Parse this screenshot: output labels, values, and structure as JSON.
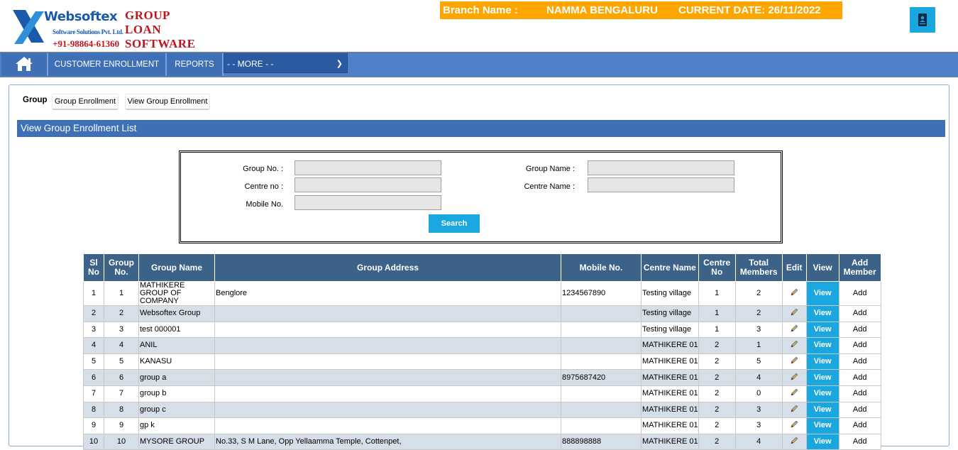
{
  "logo": {
    "brand": "Websoftex",
    "sub": "Software Solutions Pvt. Ltd.",
    "phone": "+91-98864-61360",
    "title_lines": [
      "GROUP",
      "LOAN",
      "SOFTWARE"
    ]
  },
  "branch": {
    "label": "Branch Name :",
    "name": "NAMMA BENGALURU",
    "date_label": "CURRENT DATE: 26/11/2022"
  },
  "nav": {
    "home_icon": "home-icon",
    "items": [
      "CUSTOMER ENROLLMENT",
      "REPORTS"
    ],
    "more_select": "- - MORE - -"
  },
  "tabs": {
    "label": "Group",
    "buttons": [
      "Group Enrollment",
      "View Group Enrollment"
    ]
  },
  "section_title": "View Group Enrollment List",
  "search": {
    "group_no_label": "Group No. :",
    "group_name_label": "Group Name :",
    "centre_no_label": "Centre no :",
    "centre_name_label": "Centre Name :",
    "mobile_label": "Mobile No.",
    "button": "Search"
  },
  "table": {
    "headers": [
      "Sl No",
      "Group No.",
      "Group Name",
      "Group Address",
      "Mobile No.",
      "Centre Name",
      "Centre No",
      "Total Members",
      "Edit",
      "View",
      "Add Member"
    ],
    "rows": [
      {
        "sl": "1",
        "group_no": "1",
        "name": "MATHIKERE GROUP OF COMPANY",
        "address": "Benglore",
        "mobile": "1234567890",
        "centre": "Testing village",
        "centre_no": "1",
        "members": "2",
        "view": "View",
        "add": "Add"
      },
      {
        "sl": "2",
        "group_no": "2",
        "name": "Websoftex Group",
        "address": "",
        "mobile": "",
        "centre": "Testing village",
        "centre_no": "1",
        "members": "2",
        "view": "View",
        "add": "Add"
      },
      {
        "sl": "3",
        "group_no": "3",
        "name": "test 000001",
        "address": "",
        "mobile": "",
        "centre": "Testing village",
        "centre_no": "1",
        "members": "3",
        "view": "View",
        "add": "Add"
      },
      {
        "sl": "4",
        "group_no": "4",
        "name": "ANIL",
        "address": "",
        "mobile": "",
        "centre": "MATHIKERE 01",
        "centre_no": "2",
        "members": "1",
        "view": "View",
        "add": "Add"
      },
      {
        "sl": "5",
        "group_no": "5",
        "name": "KANASU",
        "address": "",
        "mobile": "",
        "centre": "MATHIKERE 01",
        "centre_no": "2",
        "members": "5",
        "view": "View",
        "add": "Add"
      },
      {
        "sl": "6",
        "group_no": "6",
        "name": "group a",
        "address": "",
        "mobile": "8975687420",
        "centre": "MATHIKERE 01",
        "centre_no": "2",
        "members": "4",
        "view": "View",
        "add": "Add"
      },
      {
        "sl": "7",
        "group_no": "7",
        "name": "group b",
        "address": "",
        "mobile": "",
        "centre": "MATHIKERE 01",
        "centre_no": "2",
        "members": "0",
        "view": "View",
        "add": "Add"
      },
      {
        "sl": "8",
        "group_no": "8",
        "name": "group c",
        "address": "",
        "mobile": "",
        "centre": "MATHIKERE 01",
        "centre_no": "2",
        "members": "3",
        "view": "View",
        "add": "Add"
      },
      {
        "sl": "9",
        "group_no": "9",
        "name": "gp k",
        "address": "",
        "mobile": "",
        "centre": "MATHIKERE 01",
        "centre_no": "2",
        "members": "3",
        "view": "View",
        "add": "Add"
      },
      {
        "sl": "10",
        "group_no": "10",
        "name": "MYSORE GROUP",
        "address": "No.33, S M Lane, Opp Yellaamma Temple, Cottenpet,",
        "mobile": "888898888",
        "centre": "MATHIKERE 01",
        "centre_no": "2",
        "members": "4",
        "view": "View",
        "add": "Add"
      }
    ]
  },
  "icons": {
    "edit": "pencil-icon",
    "contact": "contact-book-icon"
  },
  "colors": {
    "nav": "#4f80c8",
    "branch_bar": "#ffa500",
    "table_header": "#3c6288",
    "view_button": "#1aa7e0",
    "brand_red": "#c0141c",
    "brand_blue": "#1a5aa8"
  }
}
